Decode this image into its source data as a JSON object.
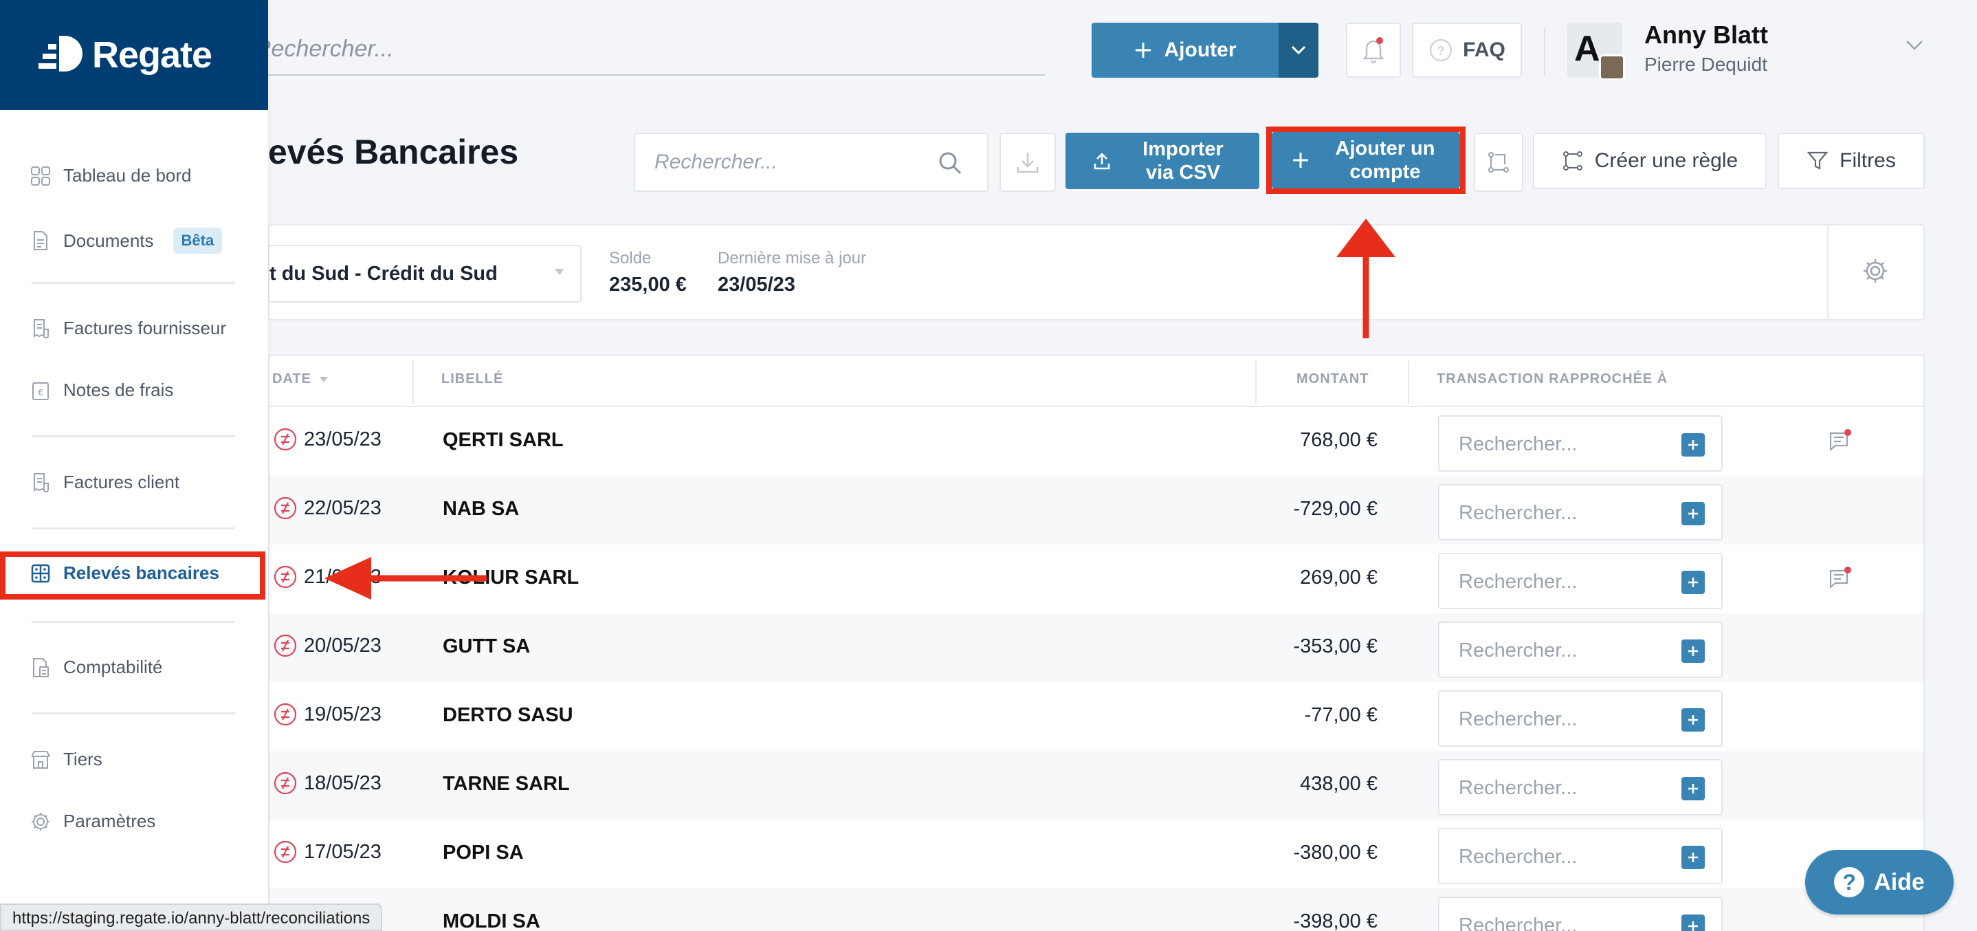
{
  "app": {
    "logo_text": "Regate"
  },
  "topbar": {
    "search_placeholder": "Rechercher...",
    "add_label": "Ajouter",
    "faq_label": "FAQ",
    "avatar_letter": "A",
    "user_name": "Anny Blatt",
    "user_org": "Pierre Dequidt"
  },
  "sidebar": {
    "items": [
      {
        "label": "Tableau de bord",
        "icon": "dashboard-icon"
      },
      {
        "label": "Documents",
        "badge": "Bêta",
        "icon": "document-icon"
      },
      {
        "label": "Factures fournisseur",
        "icon": "invoice-icon"
      },
      {
        "label": "Notes de frais",
        "icon": "expense-icon"
      },
      {
        "label": "Factures client",
        "icon": "invoice-icon"
      },
      {
        "label": "Relevés bancaires",
        "icon": "bank-statement-icon",
        "active": true
      },
      {
        "label": "Comptabilité",
        "icon": "accounting-icon"
      },
      {
        "label": "Tiers",
        "icon": "building-icon"
      },
      {
        "label": "Paramètres",
        "icon": "gear-icon"
      }
    ]
  },
  "page": {
    "title": "evés Bancaires",
    "search_placeholder": "Rechercher...",
    "import_label": "Importer via CSV",
    "add_account_label": "Ajouter un compte",
    "create_rule_label": "Créer une règle",
    "filters_label": "Filtres"
  },
  "account": {
    "selected": "t du Sud - Crédit du Sud",
    "balance_label": "Solde",
    "balance_value": "235,00 €",
    "updated_label": "Dernière mise à jour",
    "updated_value": "23/05/23"
  },
  "table": {
    "headers": {
      "date": "DATE",
      "libelle": "LIBELLÉ",
      "montant": "MONTANT",
      "rapprochee": "TRANSACTION RAPPROCHÉE À"
    },
    "search_placeholder": "Rechercher...",
    "rows": [
      {
        "date": "23/05/23",
        "libelle": "QERTI SARL",
        "montant": "768,00 €",
        "comment": true
      },
      {
        "date": "22/05/23",
        "libelle": "NAB SA",
        "montant": "-729,00 €",
        "comment": false
      },
      {
        "date": "21/05/23",
        "libelle": "KOLIUR SARL",
        "montant": "269,00 €",
        "comment": true
      },
      {
        "date": "20/05/23",
        "libelle": "GUTT SA",
        "montant": "-353,00 €",
        "comment": false
      },
      {
        "date": "19/05/23",
        "libelle": "DERTO SASU",
        "montant": "-77,00 €",
        "comment": false
      },
      {
        "date": "18/05/23",
        "libelle": "TARNE SARL",
        "montant": "438,00 €",
        "comment": false
      },
      {
        "date": "17/05/23",
        "libelle": "POPI SA",
        "montant": "-380,00 €",
        "comment": false
      },
      {
        "date": "",
        "libelle": "MOLDI SA",
        "montant": "-398,00 €",
        "comment": false
      }
    ]
  },
  "status_url": "https://staging.regate.io/anny-blatt/reconciliations",
  "help_label": "Aide",
  "colors": {
    "primary": "#3a84b3",
    "navy": "#003d73",
    "highlight": "#e62e1a",
    "unmatched": "#e0455a"
  }
}
